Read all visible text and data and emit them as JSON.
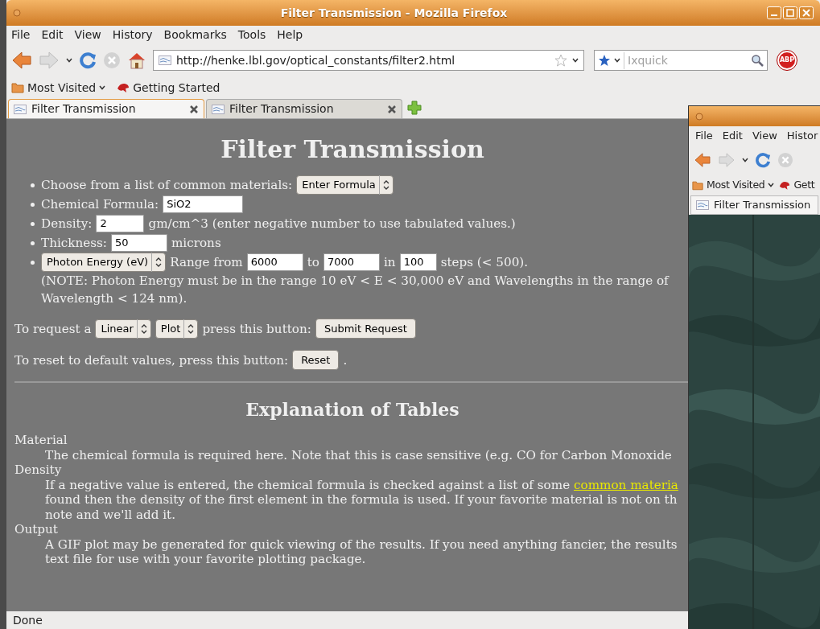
{
  "window": {
    "title": "Filter Transmission - Mozilla Firefox"
  },
  "menu": [
    "File",
    "Edit",
    "View",
    "History",
    "Bookmarks",
    "Tools",
    "Help"
  ],
  "address_bar": {
    "value": "http://henke.lbl.gov/optical_constants/filter2.html"
  },
  "search": {
    "placeholder": "Ixquick"
  },
  "addon_badge": "ABP",
  "bookmarks": [
    "Most Visited",
    "Getting Started"
  ],
  "tabs": [
    {
      "label": "Filter Transmission",
      "selected": true
    },
    {
      "label": "Filter Transmission",
      "selected": false
    }
  ],
  "page": {
    "heading": "Filter Transmission",
    "items": [
      {
        "parts": [
          {
            "kind": "text",
            "text": "Choose from a list of common materials:"
          },
          {
            "kind": "select",
            "text": "Enter Formula"
          }
        ]
      },
      {
        "parts": [
          {
            "kind": "text",
            "text": "Chemical Formula:"
          },
          {
            "kind": "input",
            "text": "SiO2"
          }
        ]
      },
      {
        "parts": [
          {
            "kind": "text",
            "text": "Density:"
          },
          {
            "kind": "input",
            "text": "2"
          },
          {
            "kind": "text",
            "text": "gm/cm^3 (enter negative number to use tabulated values.)"
          }
        ]
      },
      {
        "parts": [
          {
            "kind": "text",
            "text": "Thickness:"
          },
          {
            "kind": "input",
            "text": "50"
          },
          {
            "kind": "text",
            "text": "microns"
          }
        ]
      },
      {
        "parts": [
          {
            "kind": "select",
            "text": "Photon Energy (eV)"
          },
          {
            "kind": "text",
            "text": "Range from"
          },
          {
            "kind": "input",
            "text": "6000"
          },
          {
            "kind": "text",
            "text": "to"
          },
          {
            "kind": "input",
            "text": "7000"
          },
          {
            "kind": "text",
            "text": "in"
          },
          {
            "kind": "input",
            "text": "100"
          },
          {
            "kind": "text",
            "text": "steps (< 500)."
          }
        ],
        "note": [
          "(NOTE: Photon Energy must be in the range 10 eV < E < 30,000 eV and Wavelengths in the range of",
          "Wavelength < 124 nm)."
        ]
      }
    ],
    "request_line": [
      {
        "kind": "text",
        "text": "To request a"
      },
      {
        "kind": "select",
        "text": "Linear"
      },
      {
        "kind": "select",
        "text": "Plot"
      },
      {
        "kind": "text",
        "text": "press this button:"
      },
      {
        "kind": "button",
        "text": "Submit Request"
      }
    ],
    "reset_line": [
      {
        "kind": "text",
        "text": "To reset to default values, press this button:"
      },
      {
        "kind": "button",
        "text": "Reset"
      },
      {
        "kind": "text",
        "text": "."
      }
    ],
    "explanation_heading": "Explanation of Tables",
    "definitions": [
      {
        "term": "Material",
        "lines": [
          [
            {
              "kind": "text",
              "text": "The chemical formula is required here. Note that this is case sensitive (e.g. CO for Carbon Monoxide"
            }
          ]
        ]
      },
      {
        "term": "Density",
        "lines": [
          [
            {
              "kind": "text",
              "text": "If a negative value is entered, the chemical formula is checked against a list of some "
            },
            {
              "kind": "link",
              "text": "common materia"
            }
          ],
          [
            {
              "kind": "text",
              "text": "found then the density of the first element in the formula is used. If your favorite material is not on th"
            }
          ],
          [
            {
              "kind": "text",
              "text": "note and we'll add it."
            }
          ]
        ]
      },
      {
        "term": "Output",
        "lines": [
          [
            {
              "kind": "text",
              "text": "A GIF plot may be generated for quick viewing of the results. If you need anything fancier, the results"
            }
          ],
          [
            {
              "kind": "text",
              "text": "text file for use with your favorite plotting package."
            }
          ]
        ]
      }
    ]
  },
  "status_bar": "Done",
  "second_window": {
    "menu": [
      "File",
      "Edit",
      "View",
      "Histor"
    ],
    "bookmarks": [
      "Most Visited",
      "Gett"
    ],
    "tab": {
      "label": "Filter Transmission"
    },
    "content": {
      "kind": "picture"
    }
  }
}
